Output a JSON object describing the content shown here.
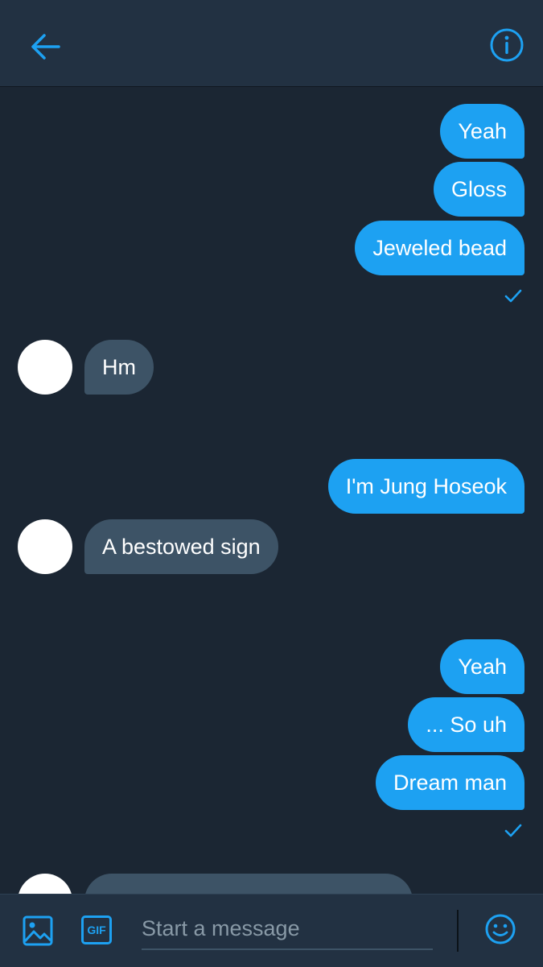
{
  "header": {
    "back_icon": "arrow-left-icon",
    "info_icon": "info-icon"
  },
  "colors": {
    "accent": "#1da1f2",
    "background": "#1b2633",
    "header": "#223142",
    "incoming_bubble": "#3d5366"
  },
  "messages": [
    {
      "from": "me",
      "text": "Yeah"
    },
    {
      "from": "me",
      "text": "Gloss"
    },
    {
      "from": "me",
      "text": "Jeweled bead",
      "status": "seen"
    },
    {
      "from": "them",
      "text": "Hm"
    },
    {
      "from": "me",
      "text": "I'm Jung Hoseok"
    },
    {
      "from": "them",
      "text": "A bestowed sign"
    },
    {
      "from": "me",
      "text": "Yeah"
    },
    {
      "from": "me",
      "text": "... So uh"
    },
    {
      "from": "me",
      "text": "Dream man",
      "status": "seen"
    },
    {
      "from": "them",
      "text": ""
    }
  ],
  "composer": {
    "media_icon": "image-icon",
    "gif_label": "GIF",
    "placeholder": "Start a message",
    "value": "",
    "emoji_icon": "emoji-icon"
  }
}
